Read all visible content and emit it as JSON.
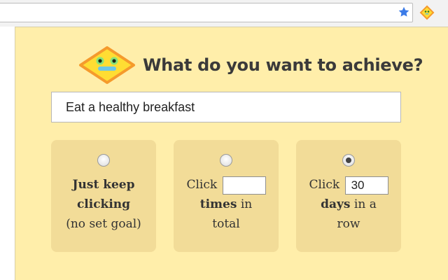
{
  "browser": {
    "bookmark_icon": "star-icon",
    "extension_icon": "diamond-face-icon"
  },
  "popup": {
    "logo_icon": "diamond-face-icon",
    "title": "What do you want to achieve?",
    "goal_input": {
      "value": "Eat a healthy breakfast"
    },
    "options": [
      {
        "selected": false,
        "line1_bold": "Just keep",
        "line2_bold": "clicking",
        "line3": "(no set goal)"
      },
      {
        "selected": false,
        "prefix": "Click",
        "input_value": "",
        "unit_bold": "times",
        "suffix_1": "in",
        "suffix_2": "total"
      },
      {
        "selected": true,
        "prefix": "Click",
        "input_value": "30",
        "unit_bold": "days",
        "suffix_1": "in a",
        "suffix_2": "row"
      }
    ]
  },
  "colors": {
    "popup_background": "#ffeeaa",
    "option_card": "#f2dc98",
    "logo_fill": "#ffdd33",
    "logo_border": "#f59a2c",
    "star": "#3b7be8"
  }
}
